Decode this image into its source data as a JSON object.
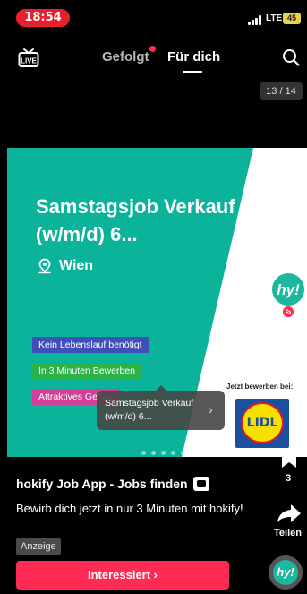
{
  "status_bar": {
    "time": "18:54",
    "network": "LTE",
    "battery": "45"
  },
  "nav": {
    "live_icon": "live-icon",
    "tab_following": "Gefolgt",
    "tab_for_you": "Für dich",
    "search_icon": "search-icon",
    "counter": "13 / 14"
  },
  "ad": {
    "title": "Samstagsjob Verkauf (w/m/d) 6...",
    "location": "Wien",
    "tags": [
      "Kein Lebenslauf benötigt",
      "In 3 Minuten Bewerben",
      "Attraktives Gehalt"
    ],
    "apply_label": "Jetzt bewerben bei:",
    "brand_logo_text": "LIDL",
    "colors": {
      "accent": "#0bb39a",
      "tag_blue": "#3d4fb8",
      "tag_green": "#2bb34a",
      "tag_pink": "#d13f96"
    }
  },
  "tooltip": {
    "text": "Samstagsjob Verkauf (w/m/d) 6..."
  },
  "rail": {
    "avatar_text": "hy!",
    "bookmark_count": "3",
    "share_label": "Teilen"
  },
  "info": {
    "author": "hokify Job App - Jobs finden",
    "caption": "Bewirb dich jetzt in nur 3 Minuten mit hokify!",
    "sponsored": "Anzeige",
    "cta": "Interessiert ›"
  },
  "colors": {
    "cta": "#fe2c55",
    "status_time_bg": "#e8202e"
  }
}
